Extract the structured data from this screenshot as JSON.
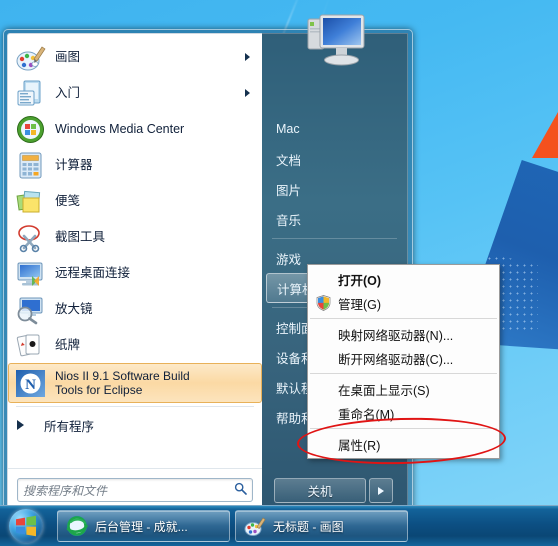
{
  "start_menu": {
    "programs": [
      {
        "label": "画图",
        "icon": "paint-icon",
        "has_submenu": true
      },
      {
        "label": "入门",
        "icon": "getting-started-icon",
        "has_submenu": true
      },
      {
        "label": "Windows Media Center",
        "icon": "windows-media-center-icon",
        "has_submenu": false
      },
      {
        "label": "计算器",
        "icon": "calculator-icon",
        "has_submenu": false
      },
      {
        "label": "便笺",
        "icon": "sticky-notes-icon",
        "has_submenu": false
      },
      {
        "label": "截图工具",
        "icon": "snipping-tool-icon",
        "has_submenu": false
      },
      {
        "label": "远程桌面连接",
        "icon": "remote-desktop-icon",
        "has_submenu": false
      },
      {
        "label": "放大镜",
        "icon": "magnifier-icon",
        "has_submenu": false
      },
      {
        "label": "纸牌",
        "icon": "solitaire-icon",
        "has_submenu": false
      }
    ],
    "highlighted_program": {
      "line1": "Nios II  9.1 Software Build",
      "line2": "Tools for Eclipse",
      "icon": "nios-ii-icon"
    },
    "all_programs_label": "所有程序",
    "search": {
      "placeholder": "搜索程序和文件",
      "value": "",
      "icon": "search-icon"
    },
    "right_pane": {
      "user_name": "Mac",
      "avatar_icon": "computer-avatar-icon",
      "items": [
        {
          "label": "Mac",
          "selected": false
        },
        {
          "label": "文档",
          "selected": false
        },
        {
          "label": "图片",
          "selected": false
        },
        {
          "label": "音乐",
          "selected": false
        },
        {
          "label": "游戏",
          "selected": false
        },
        {
          "label": "计算机",
          "selected": true
        },
        {
          "label": "控制面板",
          "selected": false
        },
        {
          "label": "设备和打印机",
          "selected": false
        },
        {
          "label": "默认程序",
          "selected": false
        },
        {
          "label": "帮助和支持",
          "selected": false
        }
      ],
      "shutdown_label": "关机",
      "shutdown_arrow_icon": "chevron-right-icon"
    }
  },
  "context_menu": {
    "items": [
      {
        "label": "打开(O)",
        "bold": true,
        "icon": null,
        "separator_after": false
      },
      {
        "label": "管理(G)",
        "bold": false,
        "icon": "uac-shield-icon",
        "separator_after": true
      },
      {
        "label": "映射网络驱动器(N)...",
        "bold": false,
        "icon": null,
        "separator_after": false
      },
      {
        "label": "断开网络驱动器(C)...",
        "bold": false,
        "icon": null,
        "separator_after": true
      },
      {
        "label": "在桌面上显示(S)",
        "bold": false,
        "icon": null,
        "separator_after": false
      },
      {
        "label": "重命名(M)",
        "bold": false,
        "icon": null,
        "separator_after": true
      },
      {
        "label": "属性(R)",
        "bold": false,
        "icon": null,
        "separator_after": false
      }
    ]
  },
  "annotation": {
    "shape": "red-ellipse",
    "color": "#e01414",
    "targets": "属性(R)"
  },
  "taskbar": {
    "start_button_label": "",
    "start_button_icon": "windows-start-orb-icon",
    "buttons": [
      {
        "label": "后台管理 - 成就...",
        "icon": "internet-explorer-icon"
      },
      {
        "label": "无标题 - 画图",
        "icon": "paint-icon"
      }
    ]
  },
  "colors": {
    "desktop": "#45b9f2",
    "accent_orange": "#f4511e",
    "highlight": "#fbd9a4",
    "annotation_red": "#e01414"
  }
}
